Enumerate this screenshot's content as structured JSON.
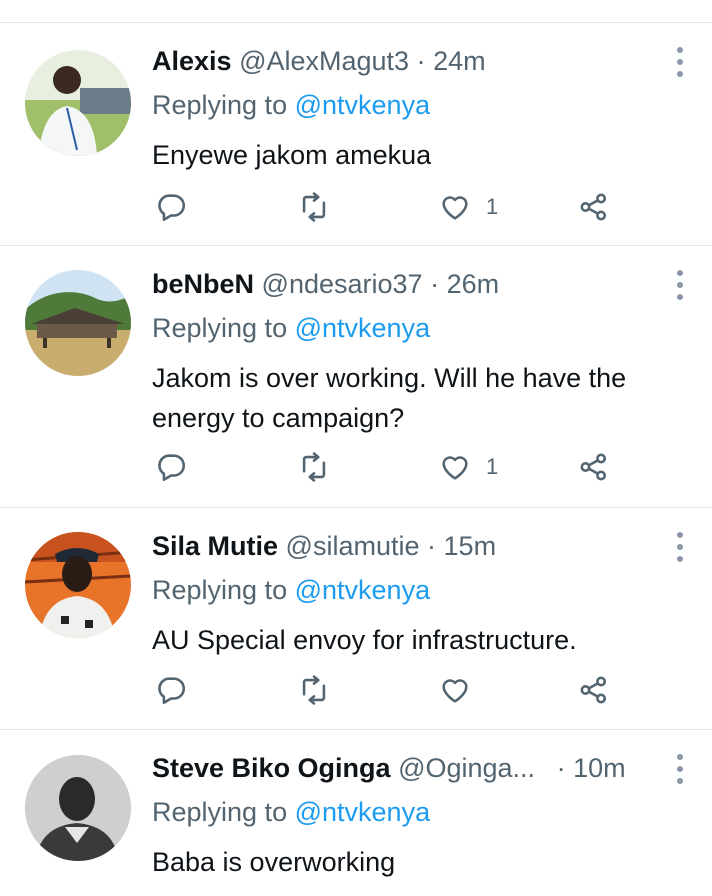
{
  "icons": {
    "reply": "reply-icon",
    "retweet": "retweet-icon",
    "like": "heart-icon",
    "share": "share-icon",
    "more": "more-options-icon"
  },
  "colors": {
    "mention": "#1d9bf0",
    "secondary_text": "#536471",
    "primary_text": "#0f1419",
    "divider": "#e1e6ea"
  },
  "tweets": [
    {
      "name": "Alexis",
      "handle": "@AlexMagut3",
      "dot": "·",
      "time": "24m",
      "replying_prefix": "Replying to",
      "replying_to": "@ntvkenya",
      "text": "Enyewe jakom amekua",
      "like_count": "1"
    },
    {
      "name": "beNbeN",
      "handle": "@ndesario37",
      "dot": "·",
      "time": "26m",
      "replying_prefix": "Replying to",
      "replying_to": "@ntvkenya",
      "text": "Jakom is over working. Will he have the energy to campaign?",
      "like_count": "1"
    },
    {
      "name": "Sila Mutie",
      "handle": "@silamutie",
      "dot": "·",
      "time": "15m",
      "replying_prefix": "Replying to",
      "replying_to": "@ntvkenya",
      "text": "AU Special envoy for infrastructure.",
      "like_count": ""
    },
    {
      "name": "Steve Biko Oginga",
      "handle": "@Oginga...",
      "dot": "·",
      "time": "10m",
      "replying_prefix": "Replying to",
      "replying_to": "@ntvkenya",
      "text": "Baba is overworking",
      "like_count": ""
    }
  ]
}
